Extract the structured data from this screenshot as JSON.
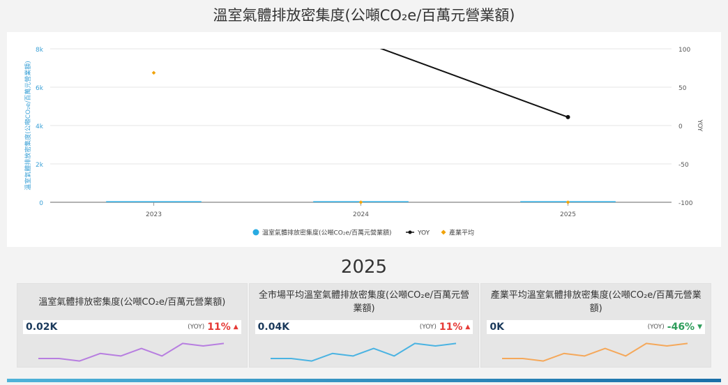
{
  "page": {
    "title": "溫室氣體排放密集度(公噸CO₂e/百萬元營業額)"
  },
  "chart_data": {
    "type": "line",
    "categories": [
      "2023",
      "2024",
      "2025"
    ],
    "ylabel": "溫室氣體排放密集度(公噸CO₂e/百萬元營業額)",
    "y2label": "YOY",
    "ylim": [
      0,
      8000
    ],
    "y2lim": [
      -100,
      100
    ],
    "yticks": [
      "0",
      "2k",
      "4k",
      "6k",
      "8k"
    ],
    "y2ticks": [
      "-100",
      "-50",
      "0",
      "50",
      "100"
    ],
    "grid": true,
    "legend": "bottom-center",
    "series": [
      {
        "name": "溫室氣體排放密集度(公噸CO₂e/百萬元營業額)",
        "kind": "bar",
        "axis": "left",
        "color": "#29abe2",
        "values": [
          20,
          20,
          20
        ]
      },
      {
        "name": "YOY",
        "kind": "line",
        "axis": "right",
        "color": "#111111",
        "values": [
          null,
          110,
          11
        ]
      },
      {
        "name": "產業平均",
        "kind": "marker",
        "axis": "left",
        "color": "#f0a30a",
        "values": [
          6750,
          0,
          0
        ]
      }
    ]
  },
  "year_heading": "2025",
  "kpis": [
    {
      "title": "溫室氣體排放密集度(公噸CO₂e/百萬元營業額)",
      "value": "0.02K",
      "yoy_label": "(YOY)",
      "yoy": "11%",
      "direction": "up",
      "arrow": "▲",
      "spark_color": "#b77ee0",
      "spark": [
        0.25,
        0.25,
        0.15,
        0.45,
        0.35,
        0.65,
        0.35,
        0.85,
        0.75,
        0.85
      ]
    },
    {
      "title": "全市場平均溫室氣體排放密集度(公噸CO₂e/百萬元營業額)",
      "value": "0.04K",
      "yoy_label": "(YOY)",
      "yoy": "11%",
      "direction": "up",
      "arrow": "▲",
      "spark_color": "#4ab3e2",
      "spark": [
        0.25,
        0.25,
        0.15,
        0.45,
        0.35,
        0.65,
        0.35,
        0.85,
        0.75,
        0.85
      ]
    },
    {
      "title": "產業平均溫室氣體排放密集度(公噸CO₂e/百萬元營業額)",
      "value": "0K",
      "yoy_label": "(YOY)",
      "yoy": "-46%",
      "direction": "down",
      "arrow": "▼",
      "spark_color": "#f5a85a",
      "spark": [
        0.25,
        0.25,
        0.15,
        0.45,
        0.35,
        0.65,
        0.35,
        0.85,
        0.75,
        0.85
      ]
    }
  ]
}
